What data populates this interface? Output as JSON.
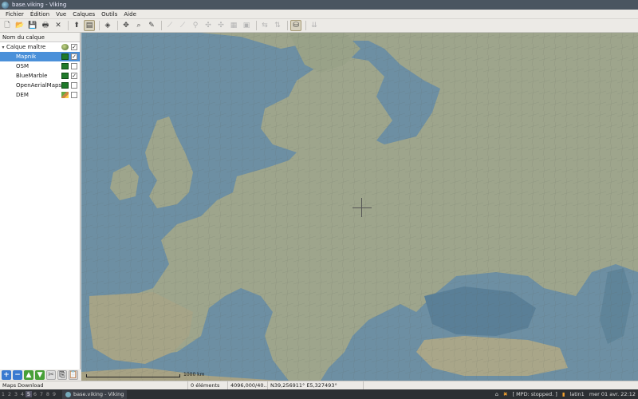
{
  "window": {
    "title": "base.viking - Viking"
  },
  "menu": [
    "Fichier",
    "Édition",
    "Vue",
    "Calques",
    "Outils",
    "Aide"
  ],
  "toolbar": {
    "buttons": [
      {
        "name": "new-file-icon",
        "glyph": "🗋",
        "dim": false
      },
      {
        "name": "open-file-icon",
        "glyph": "📂",
        "dim": false
      },
      {
        "name": "save-icon",
        "glyph": "💾",
        "dim": false
      },
      {
        "name": "print-icon",
        "glyph": "🖶",
        "dim": false
      },
      {
        "name": "close-icon",
        "glyph": "✕",
        "dim": false
      },
      {
        "sep": true
      },
      {
        "name": "select-tool-icon",
        "glyph": "⬆",
        "dim": false
      },
      {
        "name": "layer-properties-icon",
        "glyph": "▤",
        "dim": false,
        "active": true
      },
      {
        "sep": true
      },
      {
        "name": "map-tool-icon",
        "glyph": "◈",
        "dim": false
      },
      {
        "sep": true
      },
      {
        "name": "pan-tool-icon",
        "glyph": "✥",
        "dim": false
      },
      {
        "name": "zoom-tool-icon",
        "glyph": "⌕",
        "dim": false
      },
      {
        "name": "ruler-tool-icon",
        "glyph": "✎",
        "dim": false
      },
      {
        "sep": true
      },
      {
        "name": "create-track-icon",
        "glyph": "⟋",
        "dim": true
      },
      {
        "name": "create-route-icon",
        "glyph": "⟋",
        "dim": true
      },
      {
        "name": "create-waypoint-icon",
        "glyph": "⚲",
        "dim": true
      },
      {
        "name": "edit-trackpoint-icon",
        "glyph": "✣",
        "dim": true
      },
      {
        "name": "edit-waypoint-icon",
        "glyph": "✣",
        "dim": true
      },
      {
        "name": "route-finder-icon",
        "glyph": "▦",
        "dim": true
      },
      {
        "name": "show-picture-icon",
        "glyph": "▣",
        "dim": true
      },
      {
        "sep": true
      },
      {
        "name": "georef-move-icon",
        "glyph": "⇆",
        "dim": true
      },
      {
        "name": "georef-zoom-icon",
        "glyph": "⇅",
        "dim": true
      },
      {
        "sep": true
      },
      {
        "name": "maps-download-icon",
        "glyph": "⛁",
        "dim": false,
        "active": true
      },
      {
        "sep": true
      },
      {
        "name": "dem-download-icon",
        "glyph": "⇊",
        "dim": true
      }
    ]
  },
  "layers": {
    "header": "Nom du calque",
    "items": [
      {
        "name": "Calque maître",
        "type": "aggregate",
        "checked": true,
        "child": false,
        "selected": false
      },
      {
        "name": "Mapnik",
        "type": "map",
        "checked": true,
        "child": true,
        "selected": true
      },
      {
        "name": "OSM",
        "type": "map",
        "checked": false,
        "child": true,
        "selected": false
      },
      {
        "name": "BlueMarble",
        "type": "map",
        "checked": true,
        "child": true,
        "selected": false
      },
      {
        "name": "OpenAerialMaps",
        "type": "map",
        "checked": false,
        "child": true,
        "selected": false
      },
      {
        "name": "DEM",
        "type": "dem",
        "checked": false,
        "child": true,
        "selected": false
      }
    ]
  },
  "layer_buttons": [
    {
      "name": "add-layer-icon",
      "glyph": "+",
      "style": "blue"
    },
    {
      "name": "remove-layer-icon",
      "glyph": "−",
      "style": "blue"
    },
    {
      "name": "move-layer-up-icon",
      "glyph": "▲",
      "style": "green"
    },
    {
      "name": "move-layer-down-icon",
      "glyph": "▼",
      "style": "green"
    },
    {
      "name": "cut-layer-icon",
      "glyph": "✂",
      "style": "gray"
    },
    {
      "name": "copy-layer-icon",
      "glyph": "⎘",
      "style": "gray"
    },
    {
      "name": "paste-layer-icon",
      "glyph": "📋",
      "style": "gray"
    }
  ],
  "map": {
    "scale_label": "1000 km"
  },
  "status": {
    "tool": "Maps Download",
    "items": "0 éléments",
    "zoom": "4096,000/40...",
    "position": "N39,256911° E5,327493°"
  },
  "taskbar": {
    "workspaces": [
      "1",
      "2",
      "3",
      "4",
      "5",
      "6",
      "7",
      "8",
      "9"
    ],
    "active_workspace": "5",
    "task": "base.viking - Viking",
    "mpd": "[ MPD: stopped. ]",
    "keyboard": "latin1",
    "clock": "mer 01 avr. 22:12"
  },
  "colors": {
    "sea": "#6d8fa3",
    "land": "#9ea58c",
    "selection": "#4a90d9"
  }
}
